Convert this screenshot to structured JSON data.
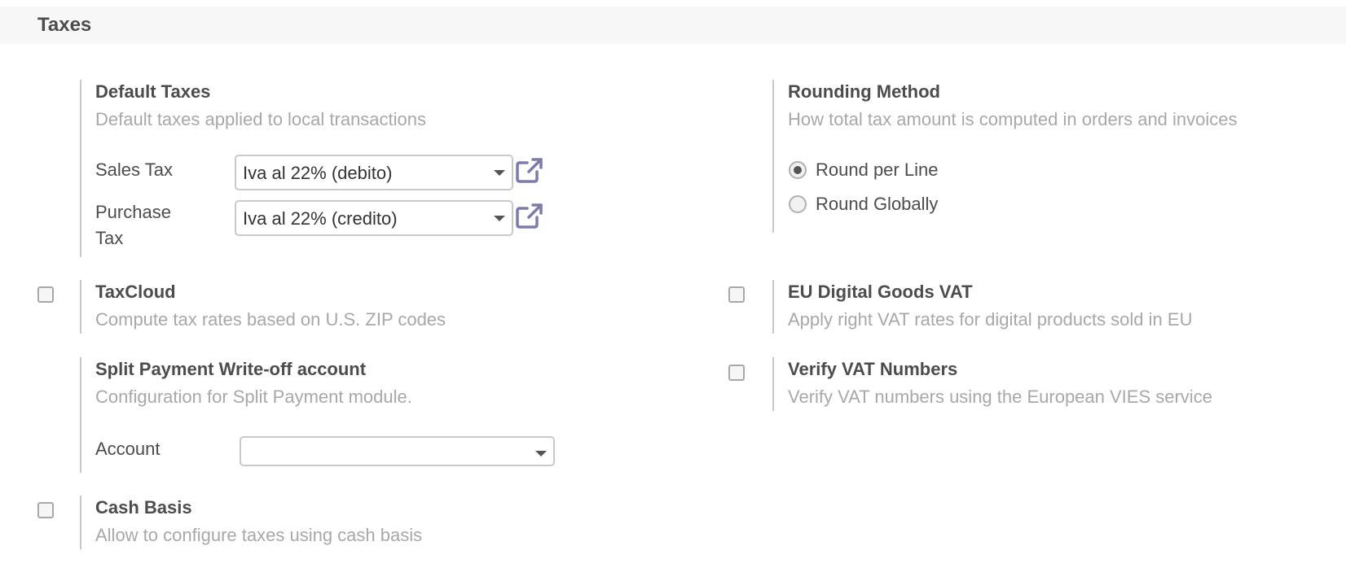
{
  "section": {
    "title": "Taxes"
  },
  "default_taxes": {
    "title": "Default Taxes",
    "description": "Default taxes applied to local transactions",
    "sales_tax": {
      "label": "Sales Tax",
      "value": "Iva al 22% (debito)"
    },
    "purchase_tax": {
      "label_line1": "Purchase",
      "label_line2": "Tax",
      "value": "Iva al 22% (credito)"
    }
  },
  "rounding": {
    "title": "Rounding Method",
    "description": "How total tax amount is computed in orders and invoices",
    "options": [
      {
        "label": "Round per Line",
        "selected": true
      },
      {
        "label": "Round Globally",
        "selected": false
      }
    ]
  },
  "taxcloud": {
    "title": "TaxCloud",
    "description": "Compute tax rates based on U.S. ZIP codes",
    "checked": false
  },
  "eu_digital": {
    "title": "EU Digital Goods VAT",
    "description": "Apply right VAT rates for digital products sold in EU",
    "checked": false
  },
  "split_payment": {
    "title": "Split Payment Write-off account",
    "description": "Configuration for Split Payment module.",
    "account": {
      "label": "Account",
      "value": ""
    }
  },
  "verify_vat": {
    "title": "Verify VAT Numbers",
    "description": "Verify VAT numbers using the European VIES service",
    "checked": false
  },
  "cash_basis": {
    "title": "Cash Basis",
    "description": "Allow to configure taxes using cash basis",
    "checked": false
  },
  "colors": {
    "accent_icon": "#7c7bad",
    "muted_text": "#a8a8a8",
    "text": "#4c4c4c"
  }
}
